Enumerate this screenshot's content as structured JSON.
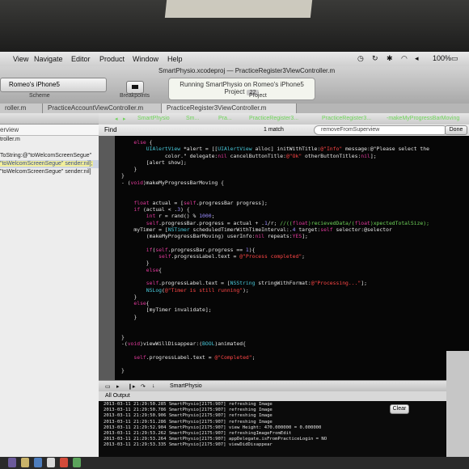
{
  "menubar": {
    "items": [
      "View",
      "Navigate",
      "Editor",
      "Product",
      "Window",
      "Help"
    ],
    "battery": "100%"
  },
  "toolbar": {
    "doc_title": "SmartPhysio.xcodeproj — PracticeRegister3ViewController.m",
    "scheme": "Romeo's iPhone5",
    "status_line": "Running SmartPhysio on Romeo's iPhone5",
    "status_project": "Project",
    "status_badge": "22",
    "scheme_label": "Scheme",
    "breakpoints_label": "Breakpoints",
    "project_label": "Project"
  },
  "tabs": [
    "roller.m",
    "PracticeAccountViewController.m",
    "PracticeRegister3ViewController.m"
  ],
  "navigator": {
    "filter": "erview",
    "rows": [
      "troller.m",
      "",
      "ToString:@\"toWelcomScreenSegue\"",
      "\"toWelcomScreenSegue\" sender:nil];",
      "\"toWelcomScreenSegue\" sender:nil]"
    ]
  },
  "jumpbar": {
    "crumbs": [
      "SmartPhysio",
      "Sm...",
      "Pra...",
      "PracticeRegister3...",
      "PracticeRegister3...",
      "-makeMyProgressBarMoving"
    ]
  },
  "find": {
    "label": "Find",
    "count": "1 match",
    "query": "removeFromSuperview",
    "done": "Done"
  },
  "code": [
    "    else {",
    "        UIAlertView *alert = [[UIAlertView alloc] initWithTitle:@\"Info\" message:@\"Please select the",
    "              color.\" delegate:nil cancelButtonTitle:@\"Ok\" otherButtonTitles:nil];",
    "        [alert show];",
    "    }",
    "}",
    "- (void)makeMyProgressBarMoving {",
    "",
    "",
    "    float actual = [self.progressBar progress];",
    "    if (actual < .3) {",
    "        int r = rand() % 1000;",
    "        self.progressBar.progress = actual + .1/r; //((float)recievedData/(float)xpectedTotalSize);",
    "    myTimer = [NSTimer scheduledTimerWithTimeInterval:.4 target:self selector:@selector",
    "        (makeMyProgressBarMoving) userInfo:nil repeats:YES];",
    "",
    "        if(self.progressBar.progress == 1){",
    "            self.progressLabel.text = @\"Process completed\";",
    "        }",
    "        else{",
    "",
    "        self.progressLabel.text = [NSString stringWithFormat:@\"Processing...\"];",
    "        NSLog(@\"Timer is still running\");",
    "    }",
    "    else{",
    "        [myTimer invalidate];",
    "    }",
    "",
    "",
    "}",
    "-(void)viewWillDisappear:(BOOL)animated{",
    "",
    "    self.progressLabel.text = @\"Completed\";",
    "",
    "}"
  ],
  "debug": {
    "process": "SmartPhysio",
    "output_label": "All Output",
    "clear": "Clear",
    "lines": [
      "2013-03-11 21:29:50.285 SmartPhysio[2175:907] refreshing Image",
      "2013-03-11 21:29:50.786 SmartPhysio[2175:907] refreshing Image",
      "2013-03-11 21:29:50.906 SmartPhysio[2175:907] refreshing Image",
      "2013-03-11 21:29:51.286 SmartPhysio[2175:907] refreshing Image",
      "2013-03-11 21:29:52.904 SmartPhysio[2175:907] view Height: 470.000000 = 0.000000",
      "2013-03-11 21:29:53.262 SmartPhysio[2175:907] refreshingImageFromEdit",
      "2013-03-11 21:29:53.264 SmartPhysio[2175:907] appDelegate.isFromPracticeLogin = NO",
      "2013-03-11 21:29:53.335 SmartPhysio[2175:907] viewDidDisappear"
    ]
  },
  "colors": {
    "editor_bg": "#060606",
    "keyword": "#e23a9c",
    "string": "#ff4646",
    "type": "#48c7d8"
  }
}
